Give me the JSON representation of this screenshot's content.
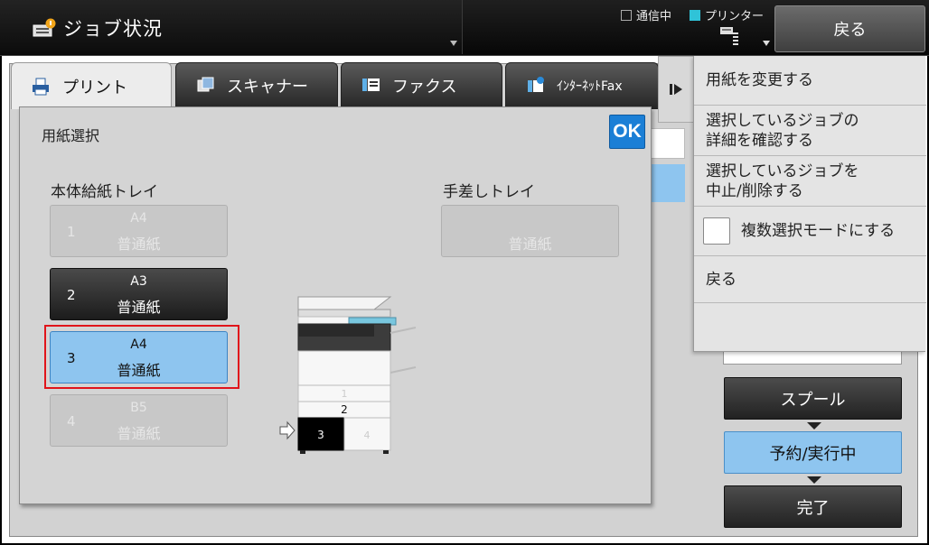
{
  "header": {
    "title": "ジョブ状況",
    "legend_comm": "通信中",
    "legend_printer": "プリンター",
    "back_label": "戻る"
  },
  "tabs": [
    {
      "label": "プリント",
      "icon": "print-tab-icon",
      "active": true
    },
    {
      "label": "スキャナー",
      "icon": "scanner-tab-icon",
      "active": false
    },
    {
      "label": "ファクス",
      "icon": "fax-tab-icon",
      "active": false
    },
    {
      "label": "ｲﾝﾀｰﾈｯﾄFax",
      "icon": "internet-fax-tab-icon",
      "active": false
    }
  ],
  "dialog": {
    "title": "用紙選択",
    "ok_label": "OK",
    "main_tray_label": "本体給紙トレイ",
    "bypass_tray_label": "手差しトレイ",
    "trays": [
      {
        "number": "1",
        "size": "A4",
        "type": "普通紙",
        "state": "disabled"
      },
      {
        "number": "2",
        "size": "A3",
        "type": "普通紙",
        "state": "available"
      },
      {
        "number": "3",
        "size": "A4",
        "type": "普通紙",
        "state": "selected"
      },
      {
        "number": "4",
        "size": "B5",
        "type": "普通紙",
        "state": "disabled"
      }
    ],
    "bypass_tray": {
      "type": "普通紙",
      "state": "disabled"
    },
    "diagram_tray_labels": [
      "1",
      "2",
      "3",
      "4"
    ],
    "diagram_selected_tray": "3"
  },
  "action_menu": {
    "items": [
      {
        "label": "用紙を変更する"
      },
      {
        "label": "選択しているジョブの\n詳細を確認する"
      },
      {
        "label": "選択しているジョブを\n中止/削除する"
      },
      {
        "label": "複数選択モードにする",
        "checked": false
      },
      {
        "label": "戻る"
      }
    ]
  },
  "status_buttons": [
    {
      "label": "スプール",
      "state": "inactive"
    },
    {
      "label": "予約/実行中",
      "state": "active"
    },
    {
      "label": "完了",
      "state": "inactive"
    }
  ],
  "colors": {
    "selected": "#8ec5ef",
    "highlight_border": "#e0141a",
    "ok_button": "#1b7fd6",
    "printer_legend": "#2fc3d8"
  }
}
